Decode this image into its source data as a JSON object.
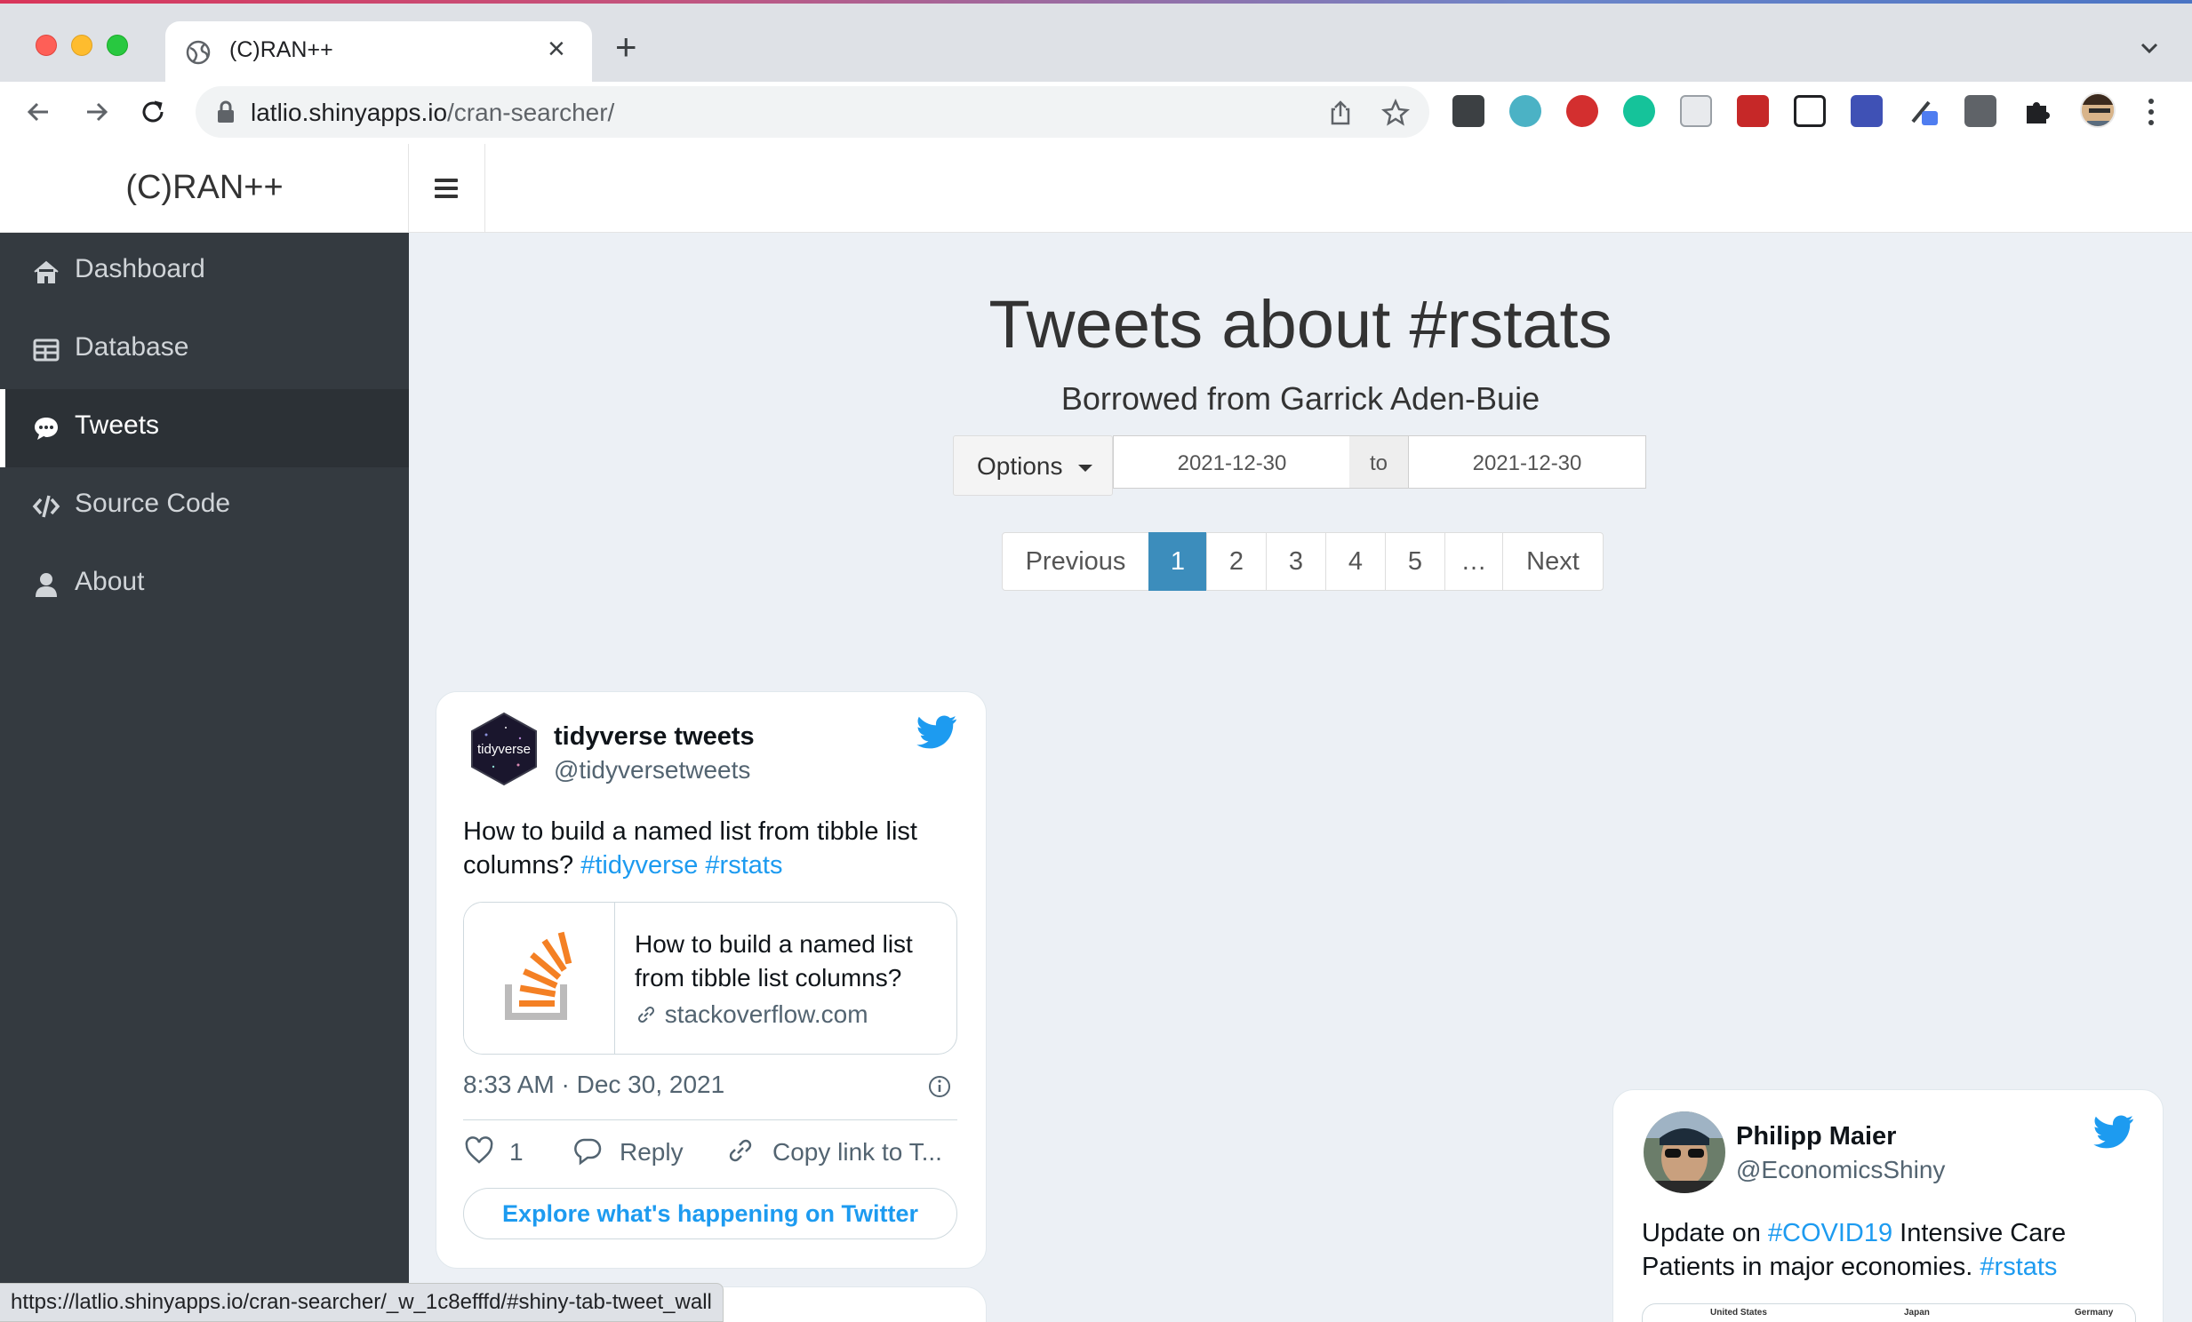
{
  "browser": {
    "tab_title": "(C)RAN++",
    "url_host": "latlio.shinyapps.io",
    "url_path": "/cran-searcher/",
    "status_url": "https://latlio.shinyapps.io/cran-searcher/_w_1c8efffd/#shiny-tab-tweet_wall",
    "extensions": [
      "dots-extension-icon",
      "mercury-extension-icon",
      "adblock-extension-icon",
      "grammarly-extension-icon",
      "document-extension-icon",
      "acrobat-extension-icon",
      "notion-extension-icon",
      "download-extension-icon",
      "eyedropper-extension-icon",
      "facebook-extension-icon",
      "puzzle-extensions-icon"
    ]
  },
  "app": {
    "logo": "(C)RAN++"
  },
  "sidebar": {
    "items": [
      {
        "label": "Dashboard",
        "icon": "home-icon",
        "active": false
      },
      {
        "label": "Database",
        "icon": "table-icon",
        "active": false
      },
      {
        "label": "Tweets",
        "icon": "comment-icon",
        "active": true
      },
      {
        "label": "Source Code",
        "icon": "code-icon",
        "active": false
      },
      {
        "label": "About",
        "icon": "user-icon",
        "active": false
      }
    ]
  },
  "main": {
    "title": "Tweets about #rstats",
    "subtitle": "Borrowed from Garrick Aden-Buie",
    "options_label": "Options",
    "date_from": "2021-12-30",
    "date_sep": "to",
    "date_to": "2021-12-30",
    "pagination": {
      "previous": "Previous",
      "pages": [
        "1",
        "2",
        "3",
        "4",
        "5"
      ],
      "ellipsis": "…",
      "next": "Next",
      "current": "1"
    }
  },
  "tweets": [
    {
      "name": "tidyverse tweets",
      "handle": "@tidyversetweets",
      "avatar_text": "tidyverse",
      "text_prefix": "How to build a named list from tibble list columns?",
      "hashtags": [
        "#tidyverse",
        "#rstats"
      ],
      "link_title": "How to build a named list from tibble list columns?",
      "link_domain": "stackoverflow.com",
      "time": "8:33 AM · Dec 30, 2021",
      "likes": "1",
      "reply_label": "Reply",
      "copy_label": "Copy link to T...",
      "explore_label": "Explore what's happening on Twitter"
    },
    {
      "name": "Philipp Maier",
      "handle": "@EconomicsShiny",
      "text_parts": [
        "Update on ",
        "#COVID19",
        " Intensive Care Patients in major economies. ",
        "#rstats"
      ],
      "chart_labels": [
        "United States",
        "Japan",
        "Germany"
      ]
    }
  ]
}
